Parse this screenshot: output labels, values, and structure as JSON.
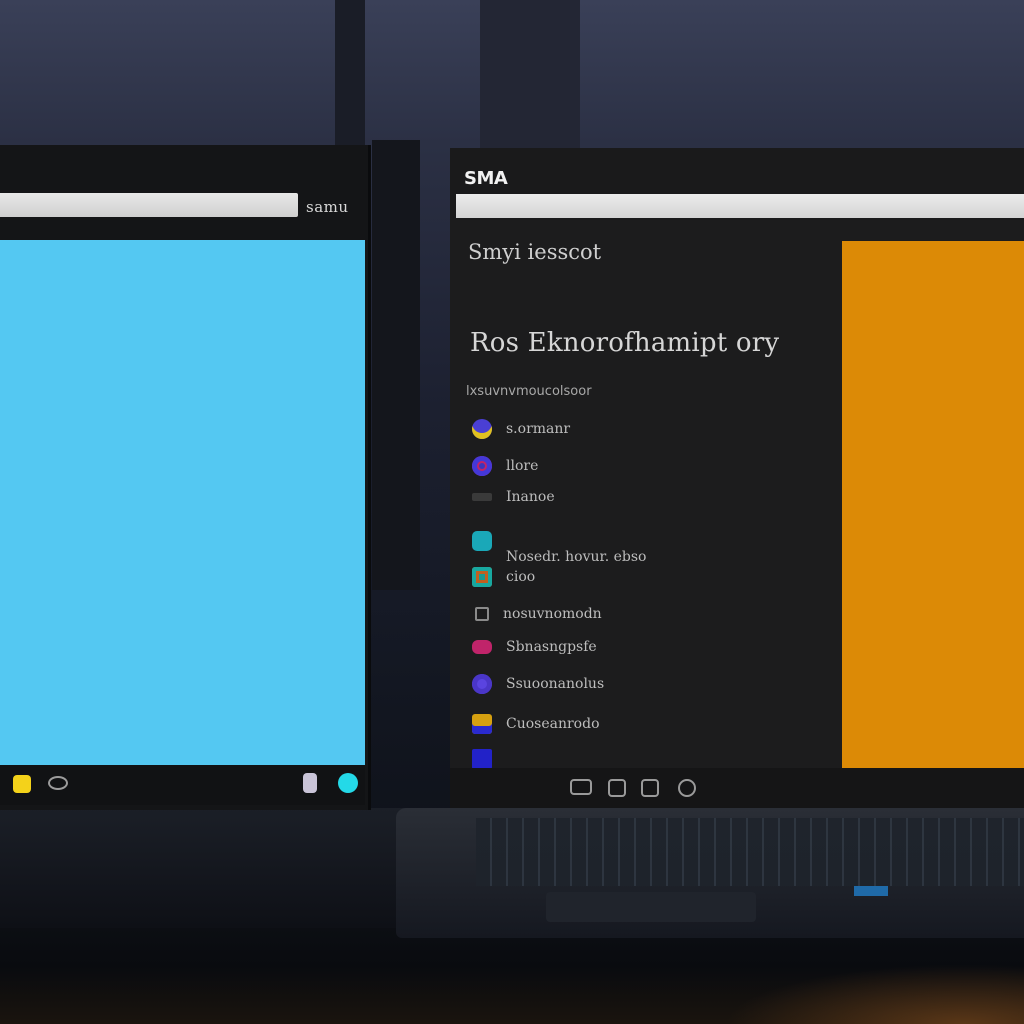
{
  "left_window": {
    "url_label": "samu",
    "canvas_color": "#54c8f2",
    "taskbar_icons": [
      "folder-icon",
      "disc-icon",
      "file-icon",
      "circle-icon"
    ]
  },
  "right_window": {
    "title": "SMA",
    "heading_small": "Smyi iesscot",
    "heading_large": "Ros Eknorofhamipt ory",
    "subheading": "lxsuvnvmoucolsoor",
    "accent_color": "#dc8a06",
    "list_items": [
      {
        "label": "s.ormanr",
        "icon": "avatar-icon",
        "color": "#4a3fd4"
      },
      {
        "label": "llore",
        "icon": "disc-icon",
        "color": "#3b35c0"
      },
      {
        "label": "Inanoe",
        "icon": "small-image-icon",
        "color": "#7a7a7a"
      },
      {
        "label": "",
        "icon": "teal-app-icon",
        "color": "#1aa8b8"
      },
      {
        "label": "Nosedr. hovur. ebso",
        "icon": "",
        "color": ""
      },
      {
        "label": "cioo",
        "icon": "photo-icon",
        "color": "#1a9a90"
      },
      {
        "label": "nosuvnomodn",
        "icon": "grid-icon",
        "color": "#777777"
      },
      {
        "label": "Sbnasngpsfe",
        "icon": "pink-app-icon",
        "color": "#c0246a"
      },
      {
        "label": "Ssuoonanolus",
        "icon": "violet-app-icon",
        "color": "#5a44e0"
      },
      {
        "label": "Cuoseanrodo",
        "icon": "yellow-app-icon",
        "color": "#d6a010"
      },
      {
        "label": "",
        "icon": "blue-app-icon",
        "color": "#2222c8"
      }
    ],
    "taskbar_icons": [
      "window-icon",
      "grid-icon",
      "calendar-icon",
      "settings-icon"
    ]
  }
}
